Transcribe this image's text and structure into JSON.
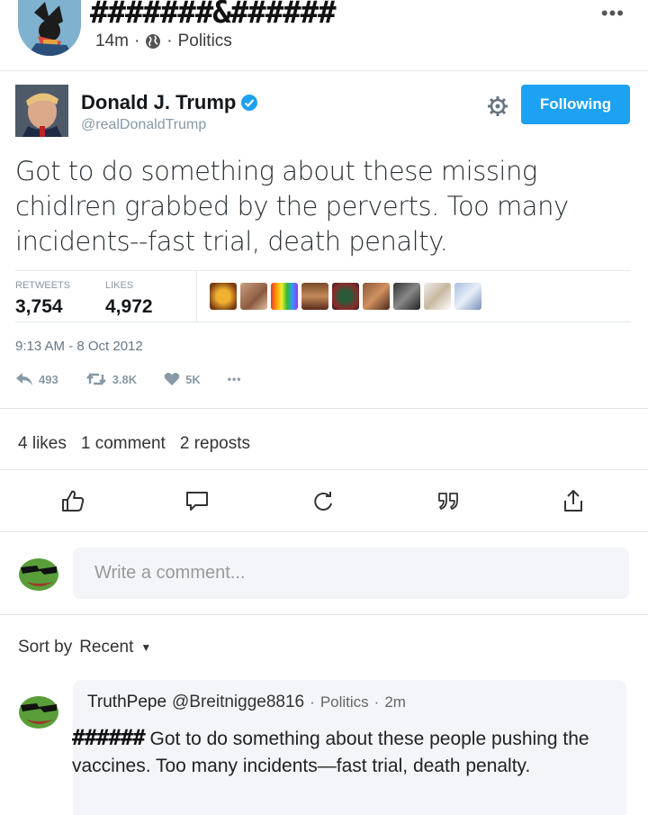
{
  "post": {
    "author_name": "#######&######",
    "time": "14m",
    "category": "Politics",
    "dot": "·"
  },
  "tweet": {
    "name": "Donald J. Trump",
    "handle": "@realDonaldTrump",
    "follow_label": "Following",
    "text": "Got to do something about these missing chidlren grabbed by the perverts. Too many incidents--fast trial, death penalty.",
    "retweets_label": "RETWEETS",
    "retweets_value": "3,754",
    "likes_label": "LIKES",
    "likes_value": "4,972",
    "timestamp": "9:13 AM - 8 Oct 2012",
    "reply_count": "493",
    "retweet_count": "3.8K",
    "like_count": "5K",
    "more": "•••"
  },
  "counts": {
    "likes": "4 likes",
    "comments": "1 comment",
    "reposts": "2 reposts"
  },
  "composer": {
    "placeholder": "Write a comment..."
  },
  "sort": {
    "label": "Sort by",
    "value": "Recent"
  },
  "comment": {
    "name": "TruthPepe",
    "handle": "@Breitnigge8816",
    "category": "Politics",
    "time": "2m",
    "dot": "·",
    "redacted": "######",
    "text": "Got to do something about these people pushing the vaccines. Too many incidents—fast trial, death penalty."
  },
  "colors": {
    "twitter_blue": "#1da1f2",
    "pepe_green": "#5a9e3a"
  }
}
